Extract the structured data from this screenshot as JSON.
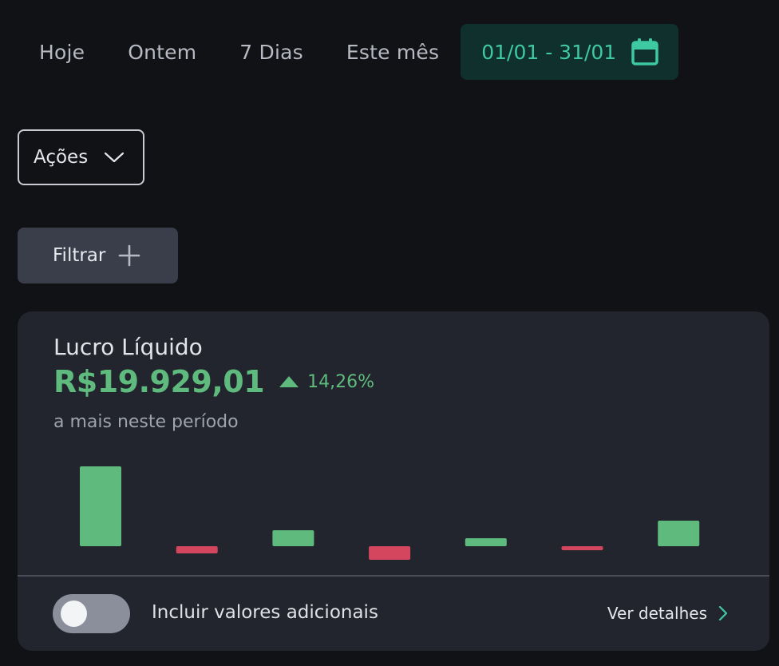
{
  "period_tabs": [
    "Hoje",
    "Ontem",
    "7 Dias",
    "Este mês"
  ],
  "date_range": {
    "label": "01/01 - 31/01",
    "icon": "calendar-icon"
  },
  "dropdown": {
    "selected": "Ações",
    "icon": "chevron-down-icon"
  },
  "filter_button": {
    "label": "Filtrar",
    "icon": "plus-icon"
  },
  "card": {
    "title": "Lucro Líquido",
    "value": "R$19.929,01",
    "delta": "14,26%",
    "delta_icon": "triangle-up-icon",
    "subtitle": "a mais neste período",
    "toggle_label": "Incluir valores adicionais",
    "toggle_on": false,
    "details_label": "Ver detalhes",
    "details_icon": "chevron-right-icon"
  },
  "colors": {
    "accent": "#3ec9a4",
    "positive": "#5fbb7d",
    "negative": "#d4465e",
    "card_bg": "#23252e",
    "page_bg": "#111216"
  },
  "chart_data": {
    "type": "bar",
    "categories": [
      "",
      "",
      "",
      "",
      "",
      "",
      ""
    ],
    "values": [
      100,
      -9,
      20,
      -17,
      10,
      -3,
      32
    ],
    "title": "",
    "xlabel": "",
    "ylabel": ""
  }
}
